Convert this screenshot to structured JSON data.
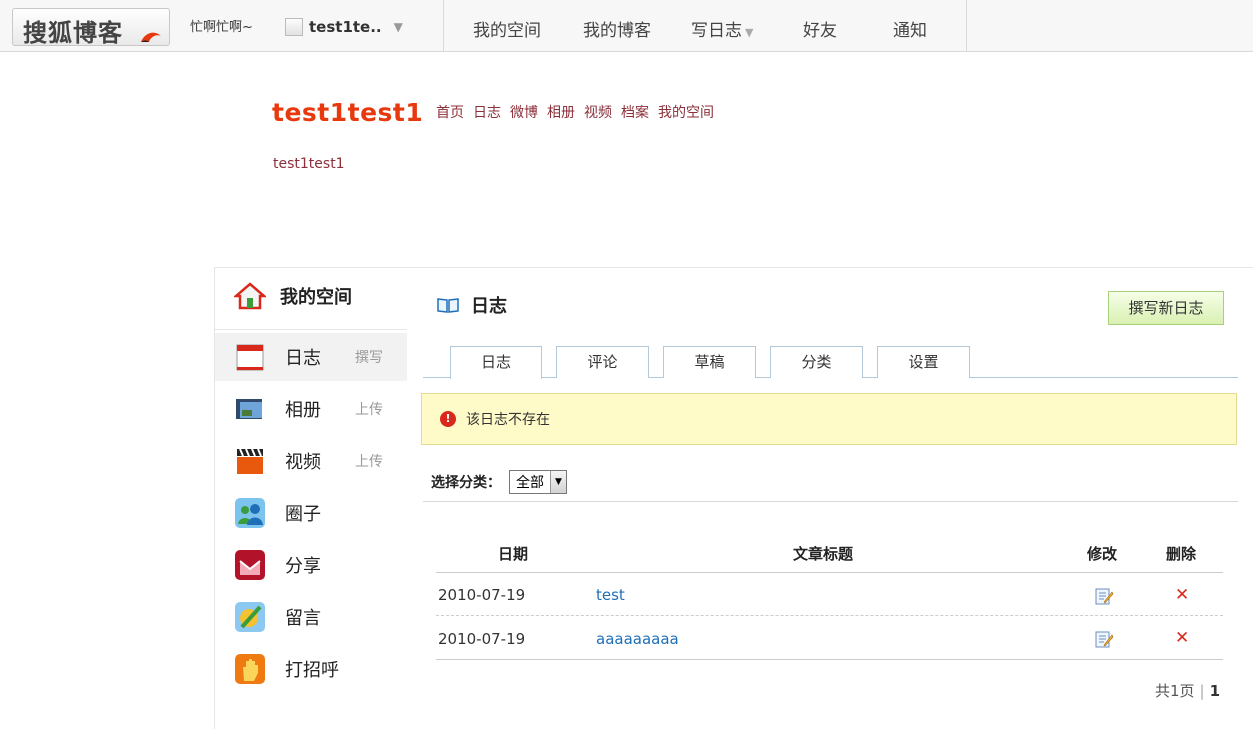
{
  "topbar": {
    "logo": "搜狐博客",
    "mood": "忙啊忙啊~",
    "username": "test1te..",
    "nav": [
      "我的空间",
      "我的博客",
      "写日志",
      "好友",
      "通知"
    ]
  },
  "blog": {
    "title": "test1test1",
    "links": [
      "首页",
      "日志",
      "微博",
      "相册",
      "视频",
      "档案",
      "我的空间"
    ],
    "subtitle": "test1test1"
  },
  "sidebar": {
    "heading": "我的空间",
    "items": [
      {
        "label": "日志",
        "action": "撰写",
        "icon": "calendar-icon"
      },
      {
        "label": "相册",
        "action": "上传",
        "icon": "photo-album-icon"
      },
      {
        "label": "视频",
        "action": "上传",
        "icon": "video-clapper-icon"
      },
      {
        "label": "圈子",
        "action": "",
        "icon": "group-icon"
      },
      {
        "label": "分享",
        "action": "",
        "icon": "share-icon"
      },
      {
        "label": "留言",
        "action": "",
        "icon": "message-icon"
      },
      {
        "label": "打招呼",
        "action": "",
        "icon": "wave-hand-icon"
      }
    ]
  },
  "content": {
    "title": "日志",
    "new_post_label": "撰写新日志",
    "tabs": [
      "日志",
      "评论",
      "草稿",
      "分类",
      "设置"
    ],
    "alert": "该日志不存在",
    "filter_label": "选择分类：",
    "filter_value": "全部",
    "table": {
      "headers": {
        "date": "日期",
        "title": "文章标题",
        "edit": "修改",
        "delete": "删除"
      },
      "rows": [
        {
          "date": "2010-07-19",
          "title": "test"
        },
        {
          "date": "2010-07-19",
          "title": "aaaaaaaaa"
        }
      ]
    },
    "pager": {
      "total": "共1页",
      "current": "1"
    }
  },
  "colors": {
    "blog_title": "#e8380d",
    "link": "#8b2f3a",
    "title_link": "#1f6fb8",
    "alert_bg": "#fffbc9",
    "delete": "#d9291c"
  }
}
